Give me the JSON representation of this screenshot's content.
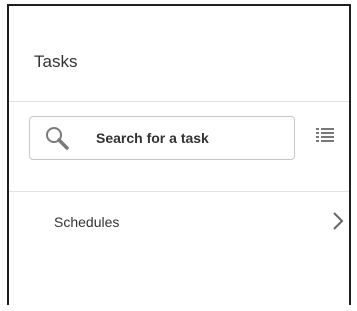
{
  "panel": {
    "title": "Tasks"
  },
  "search": {
    "placeholder": "Search for a task",
    "icon": "search-icon"
  },
  "toolbar": {
    "list_view_icon": "list-view-icon"
  },
  "nav": {
    "items": [
      {
        "label": "Schedules",
        "icon": "chevron-right-icon"
      }
    ]
  },
  "colors": {
    "text": "#333333",
    "border": "#c9c9c9",
    "divider": "#e2e2e2",
    "icon": "#777777",
    "frame": "#1f1f1f"
  }
}
